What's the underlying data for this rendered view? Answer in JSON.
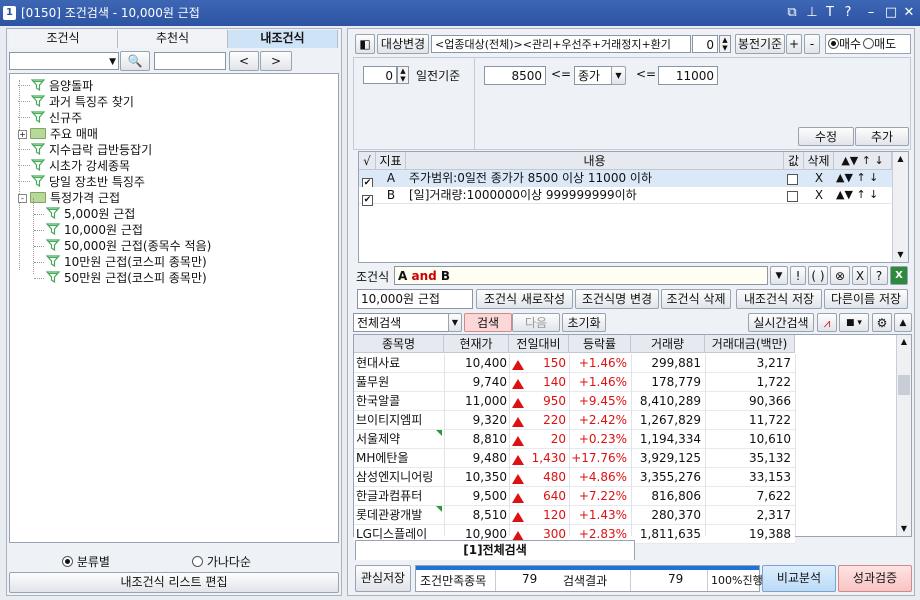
{
  "window": {
    "number": "1",
    "title": "[0150] 조건검색 - 10,000원 근접"
  },
  "tabs": [
    "조건식",
    "추천식",
    "내조건식"
  ],
  "tree": {
    "items": [
      {
        "label": "음양돌파",
        "icon": "filter-icon",
        "level": 1
      },
      {
        "label": "과거 특징주 찾기",
        "icon": "filter-icon",
        "level": 1
      },
      {
        "label": "신규주",
        "icon": "filter-icon",
        "level": 1
      },
      {
        "label": "주요 매매",
        "icon": "folder-icon",
        "level": 1,
        "expand": "+"
      },
      {
        "label": "지수급락 급반등잡기",
        "icon": "filter-icon",
        "level": 1
      },
      {
        "label": "시초가 강세종목",
        "icon": "filter-icon",
        "level": 1
      },
      {
        "label": "당일 장초반 특징주",
        "icon": "filter-icon",
        "level": 1
      },
      {
        "label": "특정가격 근접",
        "icon": "folder-icon",
        "level": 1,
        "expand": "-"
      },
      {
        "label": "5,000원 근접",
        "icon": "filter-icon",
        "level": 2
      },
      {
        "label": "10,000원 근접",
        "icon": "filter-icon",
        "level": 2
      },
      {
        "label": "50,000원 근접(종목수 적음)",
        "icon": "filter-icon",
        "level": 2
      },
      {
        "label": "10만원 근접(코스피 종목만)",
        "icon": "filter-icon",
        "level": 2
      },
      {
        "label": "50만원 근접(코스피 종목만)",
        "icon": "filter-icon",
        "level": 2
      }
    ]
  },
  "left_bottom": {
    "radio1": "분류별",
    "radio2": "가나다순",
    "edit_button": "내조건식 리스트 편집"
  },
  "toolbar": {
    "change_target": "대상변경",
    "target_text": "<업종대상(전체)><관리+우선주+거래정지+환기",
    "bong_value": "0",
    "bong_label": "봉전기준",
    "plus": "+",
    "minus": "-",
    "buy": "매수",
    "sell": "매도"
  },
  "criteria": {
    "days_value": "0",
    "days_label": "일전기준",
    "low": "8500",
    "op1": "<=",
    "field": "종가",
    "op2": "<=",
    "high": "11000",
    "modify": "수정",
    "add": "추가"
  },
  "cond_table": {
    "headers": [
      "√",
      "지표",
      "내용",
      "값",
      "삭제"
    ],
    "arrows": [
      "▲",
      "▼",
      "↑",
      "↓"
    ],
    "rows": [
      {
        "checked": "✔",
        "id": "A",
        "content": "주가범위:0일전 종가가 8500 이상 11000 이하",
        "del": "X"
      },
      {
        "checked": "✔",
        "id": "B",
        "content": "[일]거래량:1000000이상 999999999이하",
        "del": "X"
      }
    ]
  },
  "formula": {
    "label": "조건식",
    "value": "A and B",
    "ops": [
      "▼",
      "!",
      "( )",
      "⊗",
      "X",
      "?"
    ]
  },
  "actions": {
    "name": "10,000원 근접",
    "new": "조건식 새로작성",
    "rename": "조건식명 변경",
    "delete": "조건식 삭제",
    "save": "내조건식 저장",
    "save_as": "다른이름 저장"
  },
  "search_bar": {
    "scope": "전체검색",
    "search": "검색",
    "next": "다음",
    "reset": "초기화",
    "realtime": "실시간검색"
  },
  "results": {
    "headers": [
      "종목명",
      "현재가",
      "전일대비",
      "등락률",
      "거래량",
      "거래대금(백만)"
    ],
    "rows": [
      {
        "name": "현대사료",
        "price": "10,400",
        "change": "150",
        "rate": "+1.46%",
        "volume": "299,881",
        "amount": "3,217"
      },
      {
        "name": "풀무원",
        "price": "9,740",
        "change": "140",
        "rate": "+1.46%",
        "volume": "178,779",
        "amount": "1,722"
      },
      {
        "name": "한국알콜",
        "price": "11,000",
        "change": "950",
        "rate": "+9.45%",
        "volume": "8,410,289",
        "amount": "90,366"
      },
      {
        "name": "브이티지엠피",
        "price": "9,320",
        "change": "220",
        "rate": "+2.42%",
        "volume": "1,267,829",
        "amount": "11,722"
      },
      {
        "name": "서울제약",
        "price": "8,810",
        "change": "20",
        "rate": "+0.23%",
        "volume": "1,194,334",
        "amount": "10,610"
      },
      {
        "name": "MH에탄올",
        "price": "9,480",
        "change": "1,430",
        "rate": "+17.76%",
        "volume": "3,929,125",
        "amount": "35,132"
      },
      {
        "name": "삼성엔지니어링",
        "price": "10,350",
        "change": "480",
        "rate": "+4.86%",
        "volume": "3,355,276",
        "amount": "33,153"
      },
      {
        "name": "한글과컴퓨터",
        "price": "9,500",
        "change": "640",
        "rate": "+7.22%",
        "volume": "816,806",
        "amount": "7,622"
      },
      {
        "name": "롯데관광개발",
        "price": "8,510",
        "change": "120",
        "rate": "+1.43%",
        "volume": "280,370",
        "amount": "2,317"
      },
      {
        "name": "LG디스플레이",
        "price": "10,900",
        "change": "300",
        "rate": "+2.83%",
        "volume": "1,811,635",
        "amount": "19,388"
      }
    ]
  },
  "result_tab": "[1]전체검색",
  "footer": {
    "save": "관심저장",
    "matched_label": "조건만족종목",
    "matched": "79",
    "result_label": "검색결과",
    "result": "79",
    "progress": "100%진행",
    "progress_fraction": 1.0,
    "compare": "비교분석",
    "perf": "성과검증"
  }
}
